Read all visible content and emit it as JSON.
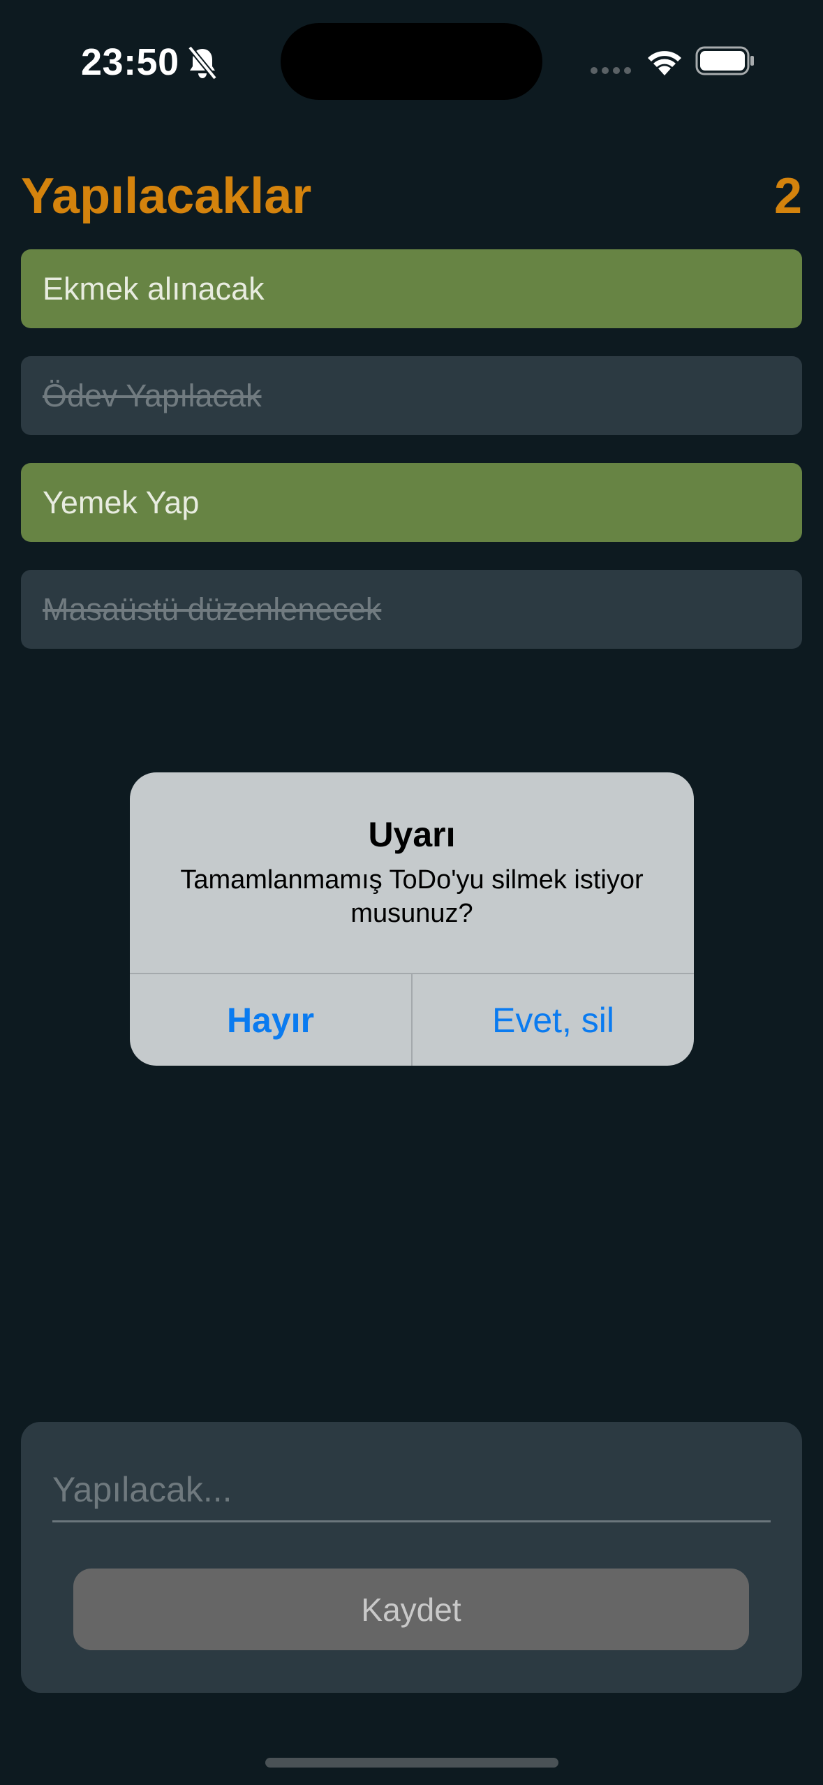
{
  "status_bar": {
    "time": "23:50",
    "icons": [
      "bell-slash-icon",
      "signal-icon",
      "wifi-icon",
      "battery-icon"
    ]
  },
  "header": {
    "title": "Yapılacaklar",
    "count": "2"
  },
  "todos": [
    {
      "text": "Ekmek alınacak",
      "completed": false
    },
    {
      "text": "Ödev Yapılacak",
      "completed": true
    },
    {
      "text": "Yemek Yap",
      "completed": false
    },
    {
      "text": "Masaüstü düzenlenecek",
      "completed": true
    }
  ],
  "alert": {
    "title": "Uyarı",
    "message": "Tamamlanmamış ToDo'yu silmek istiyor musunuz?",
    "cancel_label": "Hayır",
    "confirm_label": "Evet, sil"
  },
  "input_panel": {
    "placeholder": "Yapılacak...",
    "value": "",
    "save_label": "Kaydet"
  },
  "colors": {
    "background": "#0d1a20",
    "accent": "#d4830d",
    "active_item": "#678444",
    "done_item": "#2c3a42",
    "alert_button": "#0a7bf0"
  }
}
